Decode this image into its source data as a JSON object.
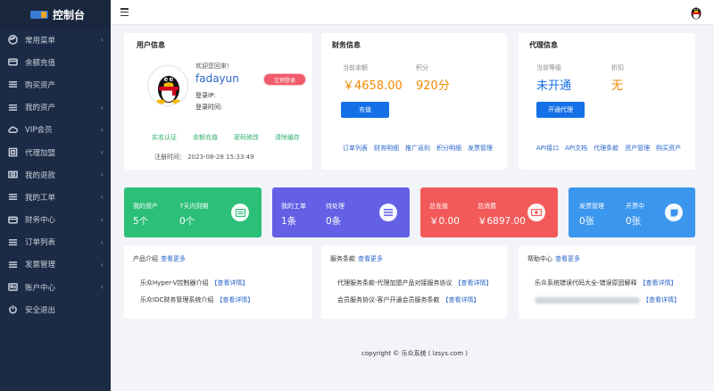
{
  "app": {
    "title": "控制台"
  },
  "sidebar": {
    "items": [
      {
        "label": "常用菜单",
        "icon": "palette-icon",
        "chevron": true
      },
      {
        "label": "余额充值",
        "icon": "card-icon",
        "chevron": false
      },
      {
        "label": "购买资产",
        "icon": "list-icon",
        "chevron": false
      },
      {
        "label": "我的资产",
        "icon": "list-icon",
        "chevron": true
      },
      {
        "label": "VIP会员",
        "icon": "cloud-icon",
        "chevron": true
      },
      {
        "label": "代理加盟",
        "icon": "frame-icon",
        "chevron": true
      },
      {
        "label": "我的退款",
        "icon": "box-icon",
        "chevron": true
      },
      {
        "label": "我的工单",
        "icon": "list-icon",
        "chevron": true
      },
      {
        "label": "财务中心",
        "icon": "card-icon",
        "chevron": true
      },
      {
        "label": "订单列表",
        "icon": "list-icon",
        "chevron": true
      },
      {
        "label": "发票管理",
        "icon": "list-icon",
        "chevron": true
      },
      {
        "label": "账户中心",
        "icon": "id-card-icon",
        "chevron": true
      },
      {
        "label": "安全退出",
        "icon": "power-icon",
        "chevron": false
      }
    ]
  },
  "user": {
    "title": "用户信息",
    "welcome": "欢迎您回来!",
    "name": "fadayun",
    "logout": "注销登录",
    "login_ip": "登录IP:",
    "login_time": "登录时间:",
    "links": [
      "实名认证",
      "余额充值",
      "密码修改",
      "清除缓存"
    ],
    "reg_time": "注册时间：  2023-08-28 15:33:49"
  },
  "finance": {
    "title": "财务信息",
    "balance_label": "当前余额",
    "balance": "￥4658.00",
    "points_label": "积分",
    "points": "920分",
    "button": "充值",
    "links": [
      "订单列表",
      "财务明细",
      "推广返利",
      "积分明细",
      "发票管理"
    ]
  },
  "agent": {
    "title": "代理信息",
    "level_label": "当前等级",
    "level": "未开通",
    "discount_label": "折扣",
    "discount": "无",
    "button": "开通代理",
    "links": [
      "API接口",
      "API文档",
      "代理条款",
      "资产管理",
      "购买资产"
    ]
  },
  "stats": [
    {
      "l1": "我的资产",
      "v1": "5个",
      "l2": "7天内到期",
      "v2": "0个",
      "color": "#2bbf78",
      "icon": "server-icon"
    },
    {
      "l1": "我的工单",
      "v1": "1条",
      "l2": "待处理",
      "v2": "0条",
      "color": "#6360e6",
      "icon": "list-icon"
    },
    {
      "l1": "总充值",
      "v1": "￥0.00",
      "l2": "总消费",
      "v2": "￥6897.00",
      "color": "#f25a5a",
      "icon": "money-icon"
    },
    {
      "l1": "发票管理",
      "v1": "0张",
      "l2": "开票中",
      "v2": "0张",
      "color": "#3b96ee",
      "icon": "note-icon"
    }
  ],
  "products": {
    "title": "产品介绍",
    "more": "查看更多",
    "items": [
      {
        "text": "乐众Hyper-V控制器介绍",
        "detail": "【查看详情】"
      },
      {
        "text": "乐众IDC财务管理系统介绍",
        "detail": "【查看详情】"
      }
    ]
  },
  "terms": {
    "title": "服务条款",
    "more": "查看更多",
    "items": [
      {
        "text": "代理服务条款-代理加盟产品对接服务协议",
        "detail": "【查看详情】"
      },
      {
        "text": "会员服务协议-客户开通会员服务条款",
        "detail": "【查看详情】"
      }
    ]
  },
  "help": {
    "title": "帮助中心",
    "more": "查看更多",
    "items": [
      {
        "text": "乐众系统错误代码大全-错误原因解释",
        "detail": "【查看详情】"
      },
      {
        "text": "",
        "detail": "【查看详情】"
      }
    ]
  },
  "footer": "copyright © 乐众系统 ( lzsys.com )",
  "colors": {
    "sidebar": "#1c2b45",
    "primary": "#1470e6",
    "balance": "#f08a00",
    "agent_level": "#1470e6",
    "discount": "#f08a00"
  }
}
